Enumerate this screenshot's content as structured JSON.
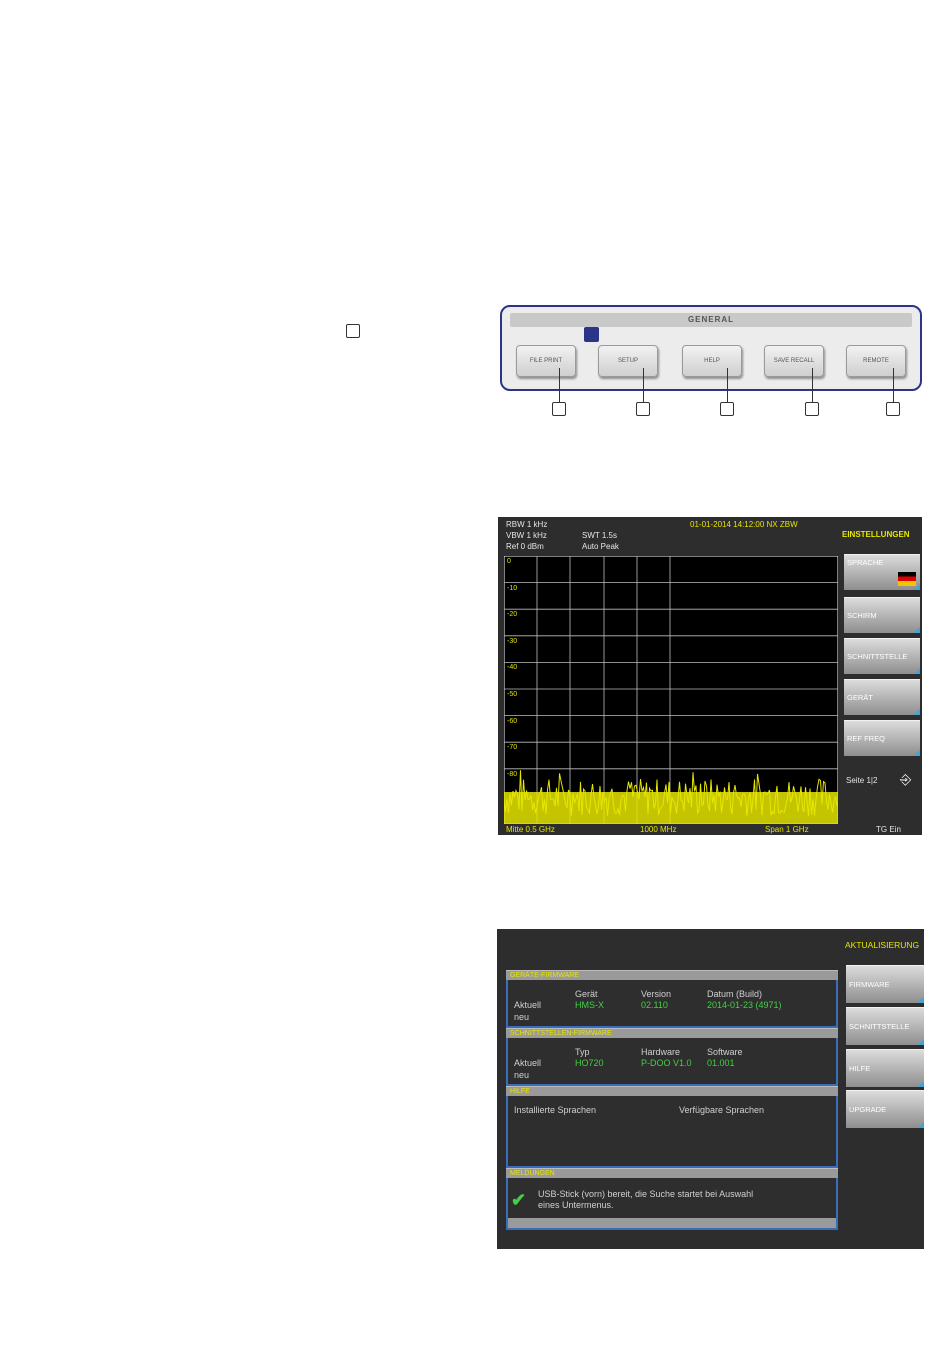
{
  "panel": {
    "strip_label": "GENERAL",
    "buttons": [
      {
        "label": "FILE PRINT",
        "name": "file-print-button"
      },
      {
        "label": "SETUP",
        "name": "setup-button"
      },
      {
        "label": "HELP",
        "name": "help-button"
      },
      {
        "label": "SAVE RECALL",
        "name": "save-recall-button"
      },
      {
        "label": "REMOTE",
        "name": "remote-button"
      }
    ],
    "led_color": "#2b3487"
  },
  "screen1": {
    "params": [
      "RBW 1 kHz",
      "VBW 1 kHz",
      "Ref 0 dBm",
      "SWT 1.5s",
      "Auto Peak"
    ],
    "top_status": "01-01-2014 14:12:00 NX ZBW",
    "menu_title": "EINSTELLUNGEN",
    "softkeys": [
      "SPRACHE",
      "SCHIRM",
      "SCHNITTSTELLE",
      "GERÄT",
      "REF FREQ"
    ],
    "page_label": "Seite 1|2",
    "y_ticks": [
      "0",
      "-10",
      "-20",
      "-30",
      "-40",
      "-50",
      "-60",
      "-70",
      "-80"
    ],
    "bottom_left": "Mitte 0.5 GHz",
    "bottom_mid": "1000 MHz",
    "bottom_right": "Span 1 GHz",
    "bottom_far_right": "TG Ein",
    "trace_color": "#e6e600"
  },
  "screen2": {
    "menu_title": "AKTUALISIERUNG",
    "softkeys": [
      "FIRMWARE",
      "SCHNITTSTELLE",
      "HILFE",
      "UPGRADE"
    ],
    "sections": {
      "device_fw": {
        "title": "GERÄTE-FIRMWARE",
        "headers": [
          "Gerät",
          "Version",
          "Datum (Build)"
        ],
        "row_labels": [
          "Aktuell",
          "neu"
        ],
        "values": [
          "HMS-X",
          "02.110",
          "2014-01-23 (4971)"
        ]
      },
      "iface_fw": {
        "title": "SCHNITTSTELLEN-FIRMWARE",
        "headers": [
          "Typ",
          "Hardware",
          "Software"
        ],
        "row_labels": [
          "Aktuell",
          "neu"
        ],
        "values": [
          "HO720",
          "P-DOO V1.0",
          "01.001"
        ]
      },
      "help": {
        "title": "HILFE",
        "installed_label": "Installierte Sprachen",
        "available_label": "Verfügbare Sprachen"
      },
      "messages": {
        "title": "MELDUNGEN",
        "message_line1": "USB-Stick (vorn) bereit, die Suche startet bei Auswahl",
        "message_line2": "eines Untermenus."
      }
    },
    "border_color": "#3b6dbf"
  }
}
